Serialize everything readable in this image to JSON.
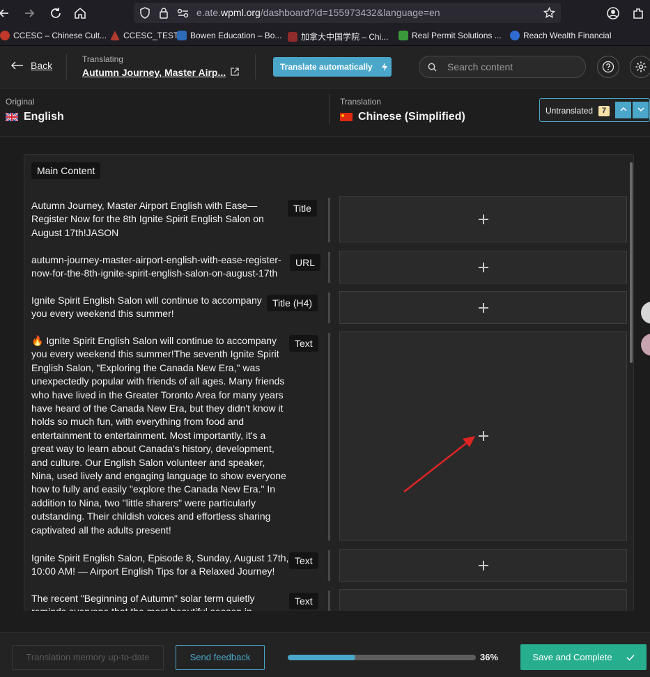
{
  "browser": {
    "url_prefix": "e.ate.",
    "url_domain": "wpml.org",
    "url_path": "/dashboard?id=155973432&language=en",
    "bookmarks": [
      {
        "label": "CCESC – Chinese Cult...",
        "icon": "ccesc-icon",
        "color": "#c0392b"
      },
      {
        "label": "CCESC_TEST",
        "icon": "ccesc-test-icon",
        "color": "#b03a2e"
      },
      {
        "label": "Bowen Education – Bo...",
        "icon": "bowen-icon",
        "color": "#2d6ab8"
      },
      {
        "label": "加拿大中国学院 – Chi...",
        "icon": "college-icon",
        "color": "#8e2b2b"
      },
      {
        "label": "Real Permit Solutions ...",
        "icon": "permit-icon",
        "color": "#3a9a3a"
      },
      {
        "label": "Reach Wealth Financial",
        "icon": "wealth-icon",
        "color": "#2f6bd1"
      }
    ]
  },
  "header": {
    "back_label": "Back",
    "translating_label": "Translating",
    "doc_title": "Autumn Journey, Master Airp...",
    "translate_auto_label": "Translate automatically",
    "search_placeholder": "Search content"
  },
  "languages": {
    "original_label": "Original",
    "original_name": "English",
    "translation_label": "Translation",
    "translation_name": "Chinese (Simplified)",
    "filter_label": "Untranslated",
    "filter_count": "7"
  },
  "main": {
    "section_label": "Main Content",
    "rows": [
      {
        "type": "Title",
        "text": "Autumn Journey, Master Airport English with Ease—Register Now for the 8th Ignite Spirit English Salon on August 17th!JASON"
      },
      {
        "type": "URL",
        "text": "autumn-journey-master-airport-english-with-ease-register-now-for-the-8th-ignite-spirit-english-salon-on-august-17th"
      },
      {
        "type": "Title (H4)",
        "text": "Ignite Spirit English Salon will continue to accompany you every weekend this summer!"
      },
      {
        "type": "Text",
        "text": "🔥 Ignite Spirit English Salon will continue to accompany you every weekend this summer!The seventh Ignite Spirit English Salon, \"Exploring the Canada New Era,\" was unexpectedly popular with friends of all ages. Many friends who have lived in the Greater Toronto Area for many years have heard of the Canada New Era, but they didn't know it holds so much fun, with everything from food and entertainment to entertainment. Most importantly, it's a great way to learn about Canada's history, development, and culture. Our English Salon volunteer and speaker, Nina, used lively and engaging language to show everyone how to fully and easily \"explore the Canada New Era.\" In addition to Nina, two \"little sharers\" were particularly outstanding. Their childish voices and effortless sharing captivated all the adults present!"
      },
      {
        "type": "Text",
        "text": "Ignite Spirit English Salon, Episode 8, Sunday, August 17th, 10:00 AM! — Airport English Tips for a Relaxed Journey!"
      },
      {
        "type": "Text",
        "text": "The recent \"Beginning of Autumn\" solar term quietly reminds everyone that the most beautiful season in"
      }
    ]
  },
  "footer": {
    "tm_label": "Translation memory up-to-date",
    "feedback_label": "Send feedback",
    "progress_percent": 36,
    "progress_label": "36%",
    "save_label": "Save and Complete"
  },
  "colors": {
    "accent": "#4ba7c9",
    "save": "#27ae8f",
    "arrow": "#e02424"
  }
}
